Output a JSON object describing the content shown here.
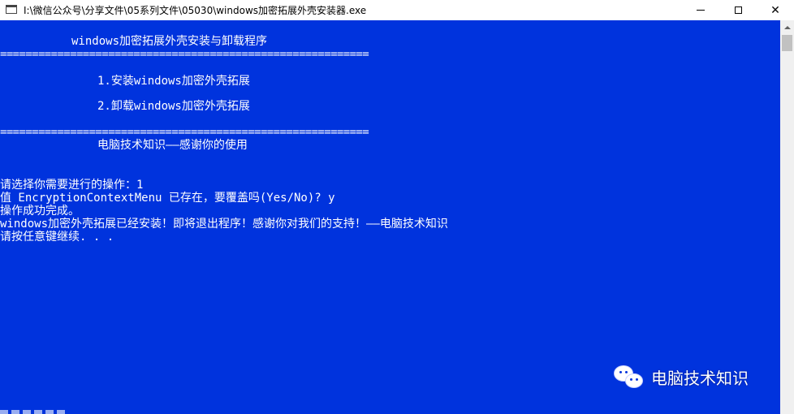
{
  "window": {
    "title": "I:\\微信公众号\\分享文件\\05系列文件\\05030\\windows加密拓展外壳安装器.exe",
    "minimize_glyph": "—",
    "maximize_glyph": "☐",
    "close_glyph": "✕"
  },
  "console": {
    "header_title": "windows加密拓展外壳安装与卸载程序",
    "separator": "==========================================================",
    "menu_option_1": "1.安装windows加密外壳拓展",
    "menu_option_2": "2.卸载windows加密外壳拓展",
    "footer_thanks": "电脑技术知识——感谢你的使用",
    "prompt_line": "请选择你需要进行的操作：1",
    "overwrite_line": "值 EncryptionContextMenu 已存在，要覆盖吗(Yes/No)? y",
    "success_line": "操作成功完成。",
    "installed_line": "windows加密外壳拓展已经安装！即将退出程序！感谢你对我们的支持！——电脑技术知识",
    "press_key_line": "请按任意键继续. . ."
  },
  "watermark": {
    "icon": "wechat-icon",
    "text": "电脑技术知识"
  },
  "colors": {
    "console_background": "#0033dd",
    "console_text": "#ffffff"
  }
}
